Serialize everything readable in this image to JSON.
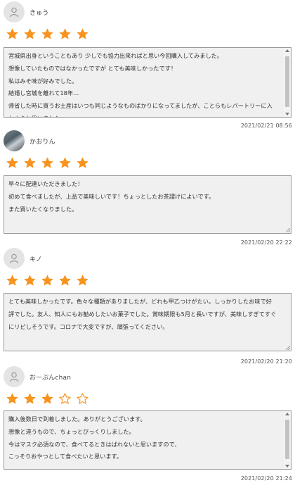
{
  "colors": {
    "star": "#f7931e",
    "box_bg": "#f0f0f0",
    "box_border": "#9a9a9a"
  },
  "reviews": [
    {
      "name": "きゅう",
      "avatar": "person-icon",
      "rating": 5,
      "text": "宮城県出身ということもあり 少しでも協力出来ればと思い今回購入してみました。\n想像していたものではなかったですが とても美味しかったです！\n私はみそ味が好みでした。\n結婚し宮城を離れて18年…\n帰省した時に買うお土産はいつも同じようなものばかりになってましたが、ことらもレパートリーに入れようと思いました。",
      "date": "2021/02/21 08:56"
    },
    {
      "name": "かおりん",
      "avatar": "profile-photo",
      "rating": 5,
      "text": "早々に配達いただきました！\n初めて食べましたが、上品で美味しいです！ちょっとしたお茶請けによいです。\nまた買いたくなりました。",
      "date": "2021/02/20 22:22"
    },
    {
      "name": "キノ",
      "avatar": "person-icon",
      "rating": 5,
      "text": "とても美味しかったです。色々な種類がありましたが、どれも甲乙つけがたい。しっかりしたお味で好評でした。友人、知人にもお勧めしたいお菓子でした。賞味期限も5月と長いですが、美味しすぎてすぐにリピしそうです。コロナで大変ですが、頑張ってください。",
      "date": "2021/02/20 21:20"
    },
    {
      "name": "おーぷんchan",
      "avatar": "person-icon",
      "rating": 3,
      "text": "購入後数日で到着しました。ありがとうございます。\n想像と違うもので、ちょっとびっくりしました。\n今はマスク必須なので、食べてるときはばれないと思いますので、\nこっそりおやつとして食べたいと思います。",
      "date": "2021/02/20 21:24"
    }
  ]
}
